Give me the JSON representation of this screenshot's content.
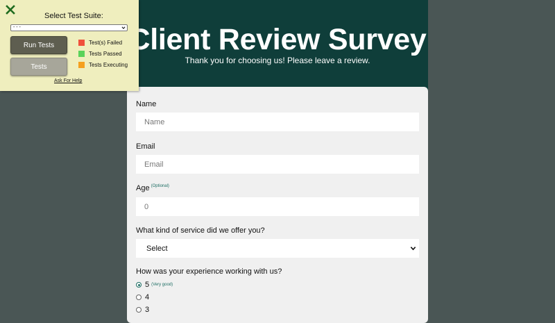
{
  "header": {
    "title": "Client Review Survey",
    "subtitle": "Thank you for choosing us! Please leave a review."
  },
  "form": {
    "name": {
      "label": "Name",
      "placeholder": "Name"
    },
    "email": {
      "label": "Email",
      "placeholder": "Email"
    },
    "age": {
      "label": "Age",
      "note": "(Optional)",
      "placeholder": "0"
    },
    "service": {
      "label": "What kind of service did we offer you?",
      "selected": "Select"
    },
    "experience": {
      "label": "How was your experience working with us?",
      "options": [
        {
          "value": "5",
          "note": "(Very good)",
          "checked": true
        },
        {
          "value": "4",
          "note": "",
          "checked": false
        },
        {
          "value": "3",
          "note": "",
          "checked": false
        }
      ]
    }
  },
  "test_panel": {
    "suite_title": "Select Test Suite:",
    "suite_selected": "- - -",
    "run_tests_label": "Run Tests",
    "tests_label": "Tests",
    "legend": [
      {
        "label": "Test(s) Failed",
        "color": "#f0503c"
      },
      {
        "label": "Tests Passed",
        "color": "#5ad25a"
      },
      {
        "label": "Tests Executing",
        "color": "#f5a01e"
      }
    ],
    "help_label": "Ask For Help"
  },
  "colors": {
    "background": "#4a5655",
    "header": "#0f3e3a",
    "card": "#f0f0f0",
    "panel": "#efeebe",
    "close_icon": "#1f6b1f"
  }
}
